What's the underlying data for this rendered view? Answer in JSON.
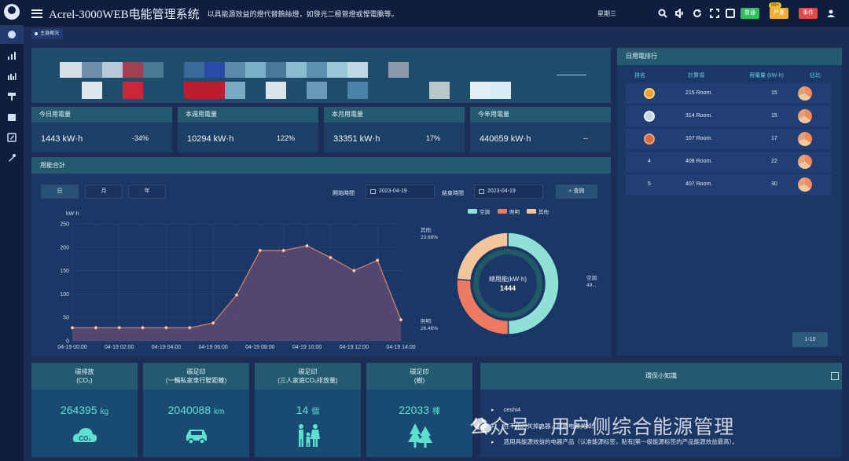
{
  "app": {
    "title": "Acrel-3000WEB电能管理系统",
    "slogan": "以具能源效益的燈代替鎢絲燈，如發光二極管燈或慳電膽等。",
    "weekday": "星期三",
    "buttons": {
      "green": "普通",
      "yellow": "严重",
      "red": "事件"
    },
    "badge": "99+"
  },
  "breadcrumb": "主頁概況",
  "stats": [
    {
      "label": "今日用電量",
      "value": "1443 kW·h",
      "pct": "-34%"
    },
    {
      "label": "本週用電量",
      "value": "10294 kW·h",
      "pct": "122%"
    },
    {
      "label": "本月用電量",
      "value": "33351 kW·h",
      "pct": "17%"
    },
    {
      "label": "今年用電量",
      "value": "440659 kW·h",
      "pct": "--"
    }
  ],
  "energy": {
    "title": "用能合計",
    "tabs": [
      "日",
      "月",
      "年"
    ],
    "start_label": "開始時間",
    "end_label": "結束時間",
    "start_date": "2023-04-19",
    "end_date": "2023-04-19",
    "query": "查詢"
  },
  "chart_data": [
    {
      "type": "area",
      "ylabel": "kW·h",
      "ylim": [
        0,
        250
      ],
      "yticks": [
        0,
        50,
        100,
        150,
        200,
        250
      ],
      "xticks": [
        "04-19 00:00",
        "04-19 02:00",
        "04-19 04:00",
        "04-19 06:00",
        "04-19 08:00",
        "04-19 10:00",
        "04-19 12:00",
        "04-19 14:00"
      ],
      "x": [
        "00:00",
        "01:00",
        "02:00",
        "03:00",
        "04:00",
        "05:00",
        "06:00",
        "07:00",
        "08:00",
        "09:00",
        "10:00",
        "11:00",
        "12:00",
        "13:00",
        "14:00"
      ],
      "values": [
        28,
        28,
        28,
        28,
        28,
        28,
        38,
        98,
        193,
        193,
        203,
        178,
        150,
        172,
        45
      ],
      "colors": {
        "line": "#e0836a",
        "fill": "#5a4a72"
      },
      "grid": true
    },
    {
      "type": "pie",
      "center_title": "總用能(kW·h)",
      "center_value": "1444",
      "legend": [
        "空調",
        "照明",
        "其他"
      ],
      "slices": [
        {
          "name": "空調",
          "label": "空調:",
          "value": 49.86,
          "pct_text": "49...",
          "color": "#8fe0d6"
        },
        {
          "name": "照明",
          "label": "照明:",
          "value": 26.46,
          "pct_text": "26.46%",
          "color": "#ee7a62"
        },
        {
          "name": "其他",
          "label": "其他:",
          "value": 23.68,
          "pct_text": "23.68%",
          "color": "#f3c59c"
        }
      ]
    }
  ],
  "ranking": {
    "title": "日用電排行",
    "columns": [
      "排名",
      "計算項",
      "用電量 (kW·h)",
      "佔比"
    ],
    "rows": [
      {
        "rank": "",
        "medal": "gold",
        "item": "215 Room.",
        "value": "15"
      },
      {
        "rank": "",
        "medal": "silver",
        "item": "314 Room.",
        "value": "15"
      },
      {
        "rank": "",
        "medal": "bronze",
        "item": "107 Room.",
        "value": "17"
      },
      {
        "rank": "4",
        "medal": "",
        "item": "408 Room.",
        "value": "22"
      },
      {
        "rank": "5",
        "medal": "",
        "item": "407 Room.",
        "value": "30"
      }
    ],
    "pager": "1-10"
  },
  "bottom_cards": [
    {
      "title1": "碳排放",
      "title2": "(CO₂)",
      "value": "264395",
      "unit": "kg",
      "icon": "co2-cloud-icon"
    },
    {
      "title1": "碳足印",
      "title2": "(一輛私家車行駛距離)",
      "value": "2040088",
      "unit": "km",
      "icon": "car-icon"
    },
    {
      "title1": "碳足印",
      "title2": "(三人家庭CO₂排放量)",
      "value": "14",
      "unit": "個",
      "icon": "family-icon"
    },
    {
      "title1": "碳足印",
      "title2": "(樹)",
      "value": "22033",
      "unit": "棵",
      "icon": "tree-icon"
    }
  ],
  "tips": {
    "title": "環保小知識",
    "items": [
      "ceshi4",
      "在不用时关掉电器，应将电源关掉。",
      "选用具能源效益的电器产品（认准能源标签，贴有[第一级能源标签的产品能源效益最高）。"
    ]
  },
  "watermark": "公众号 · 用户侧综合能源管理",
  "colors": {
    "accent": "#5ee0d0",
    "header_bg": "#0f1d3f",
    "panel_bg": "#1b3766",
    "card_head": "#235a6f"
  }
}
